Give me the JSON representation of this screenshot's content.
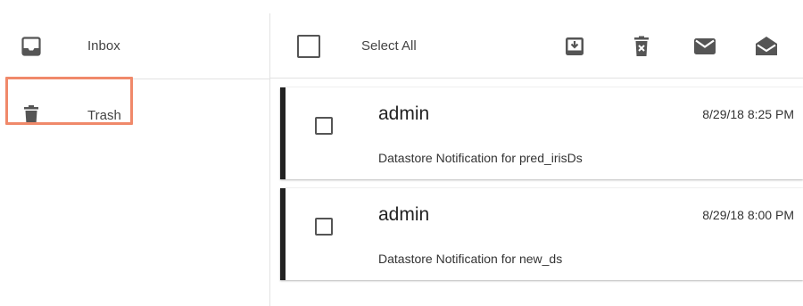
{
  "sidebar": {
    "items": [
      {
        "label": "Inbox",
        "icon": "inbox-icon"
      },
      {
        "label": "Trash",
        "icon": "trash-icon"
      }
    ],
    "highlight_color": "#f0896a"
  },
  "toolbar": {
    "select_all_label": "Select All",
    "actions": [
      "download-icon",
      "delete-icon",
      "mark-unread-icon",
      "mark-read-icon"
    ]
  },
  "messages": [
    {
      "sender": "admin",
      "time": "8/29/18 8:25 PM",
      "subject": "Datastore Notification for pred_irisDs"
    },
    {
      "sender": "admin",
      "time": "8/29/18 8:00 PM",
      "subject": "Datastore Notification for new_ds"
    }
  ],
  "colors": {
    "accent_bar": "#222222",
    "icon": "#555555",
    "divider": "#e2e2e2"
  }
}
